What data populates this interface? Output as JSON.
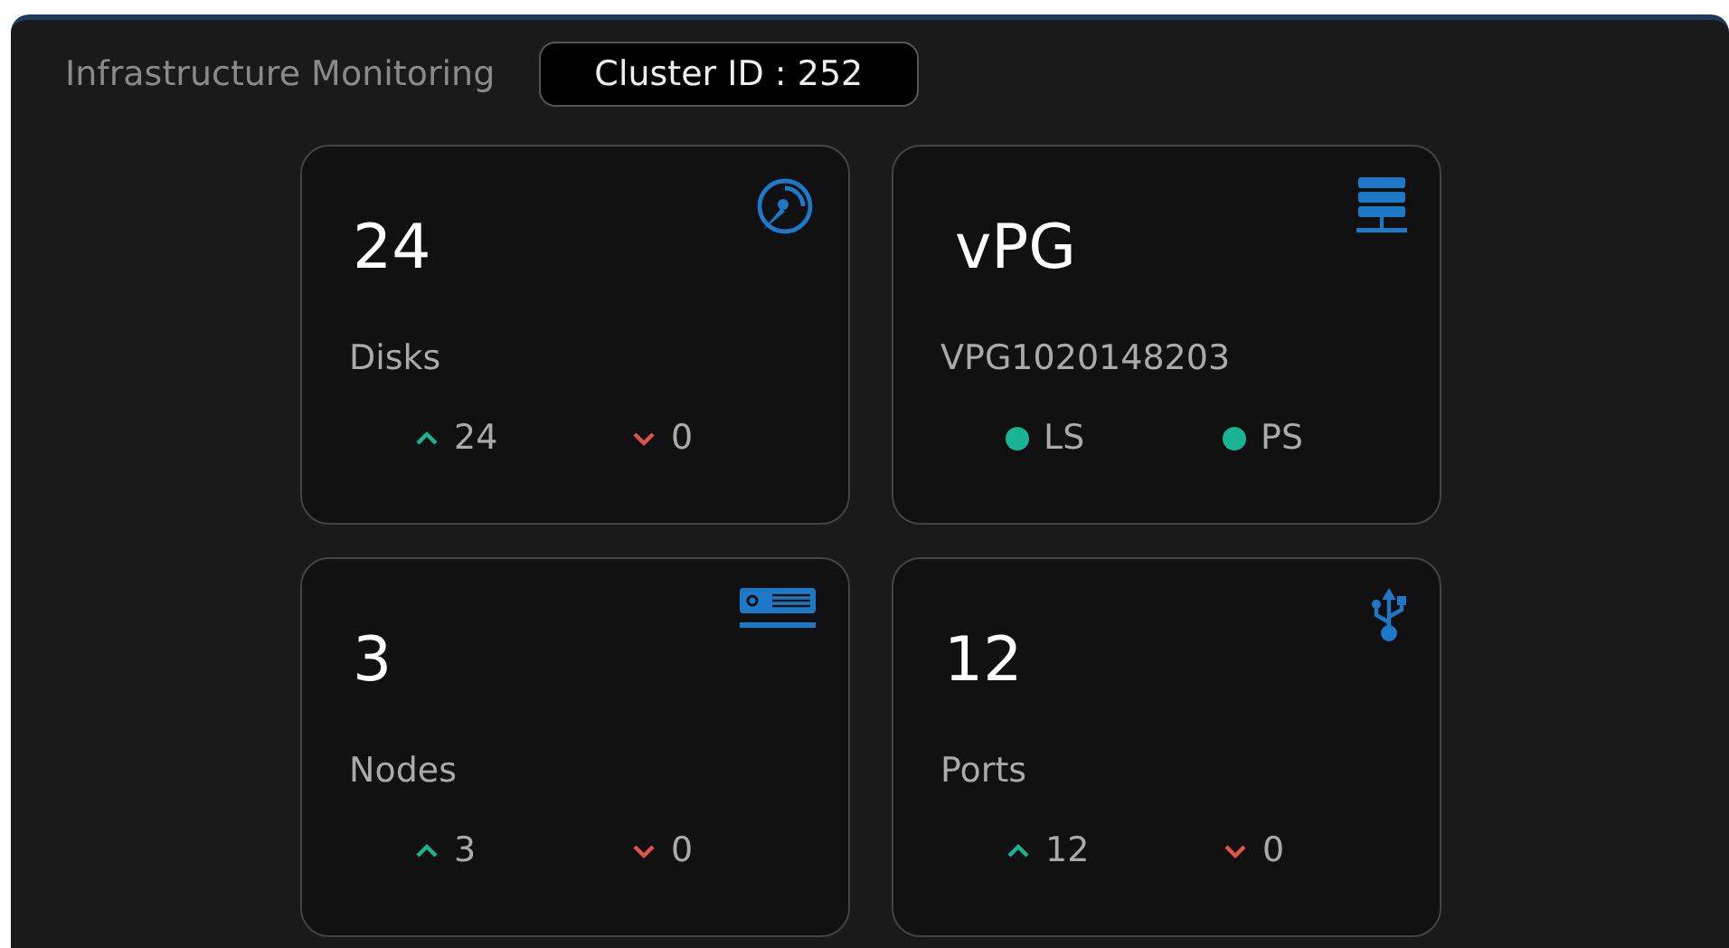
{
  "header": {
    "title": "Infrastructure Monitoring",
    "cluster": "Cluster ID : 252"
  },
  "cards": [
    {
      "kind": "disk",
      "value": "24",
      "label": "Disks",
      "up": "24",
      "down": "0"
    },
    {
      "kind": "pool",
      "value": "vPG",
      "label": "VPG1020148203",
      "indicators": [
        {
          "label": "LS",
          "color": "#1ab394"
        },
        {
          "label": "PS",
          "color": "#1ab394"
        }
      ]
    },
    {
      "kind": "node",
      "value": "3",
      "label": "Nodes",
      "up": "3",
      "down": "0"
    },
    {
      "kind": "port",
      "value": "12",
      "label": "Ports",
      "up": "12",
      "down": "0"
    }
  ]
}
